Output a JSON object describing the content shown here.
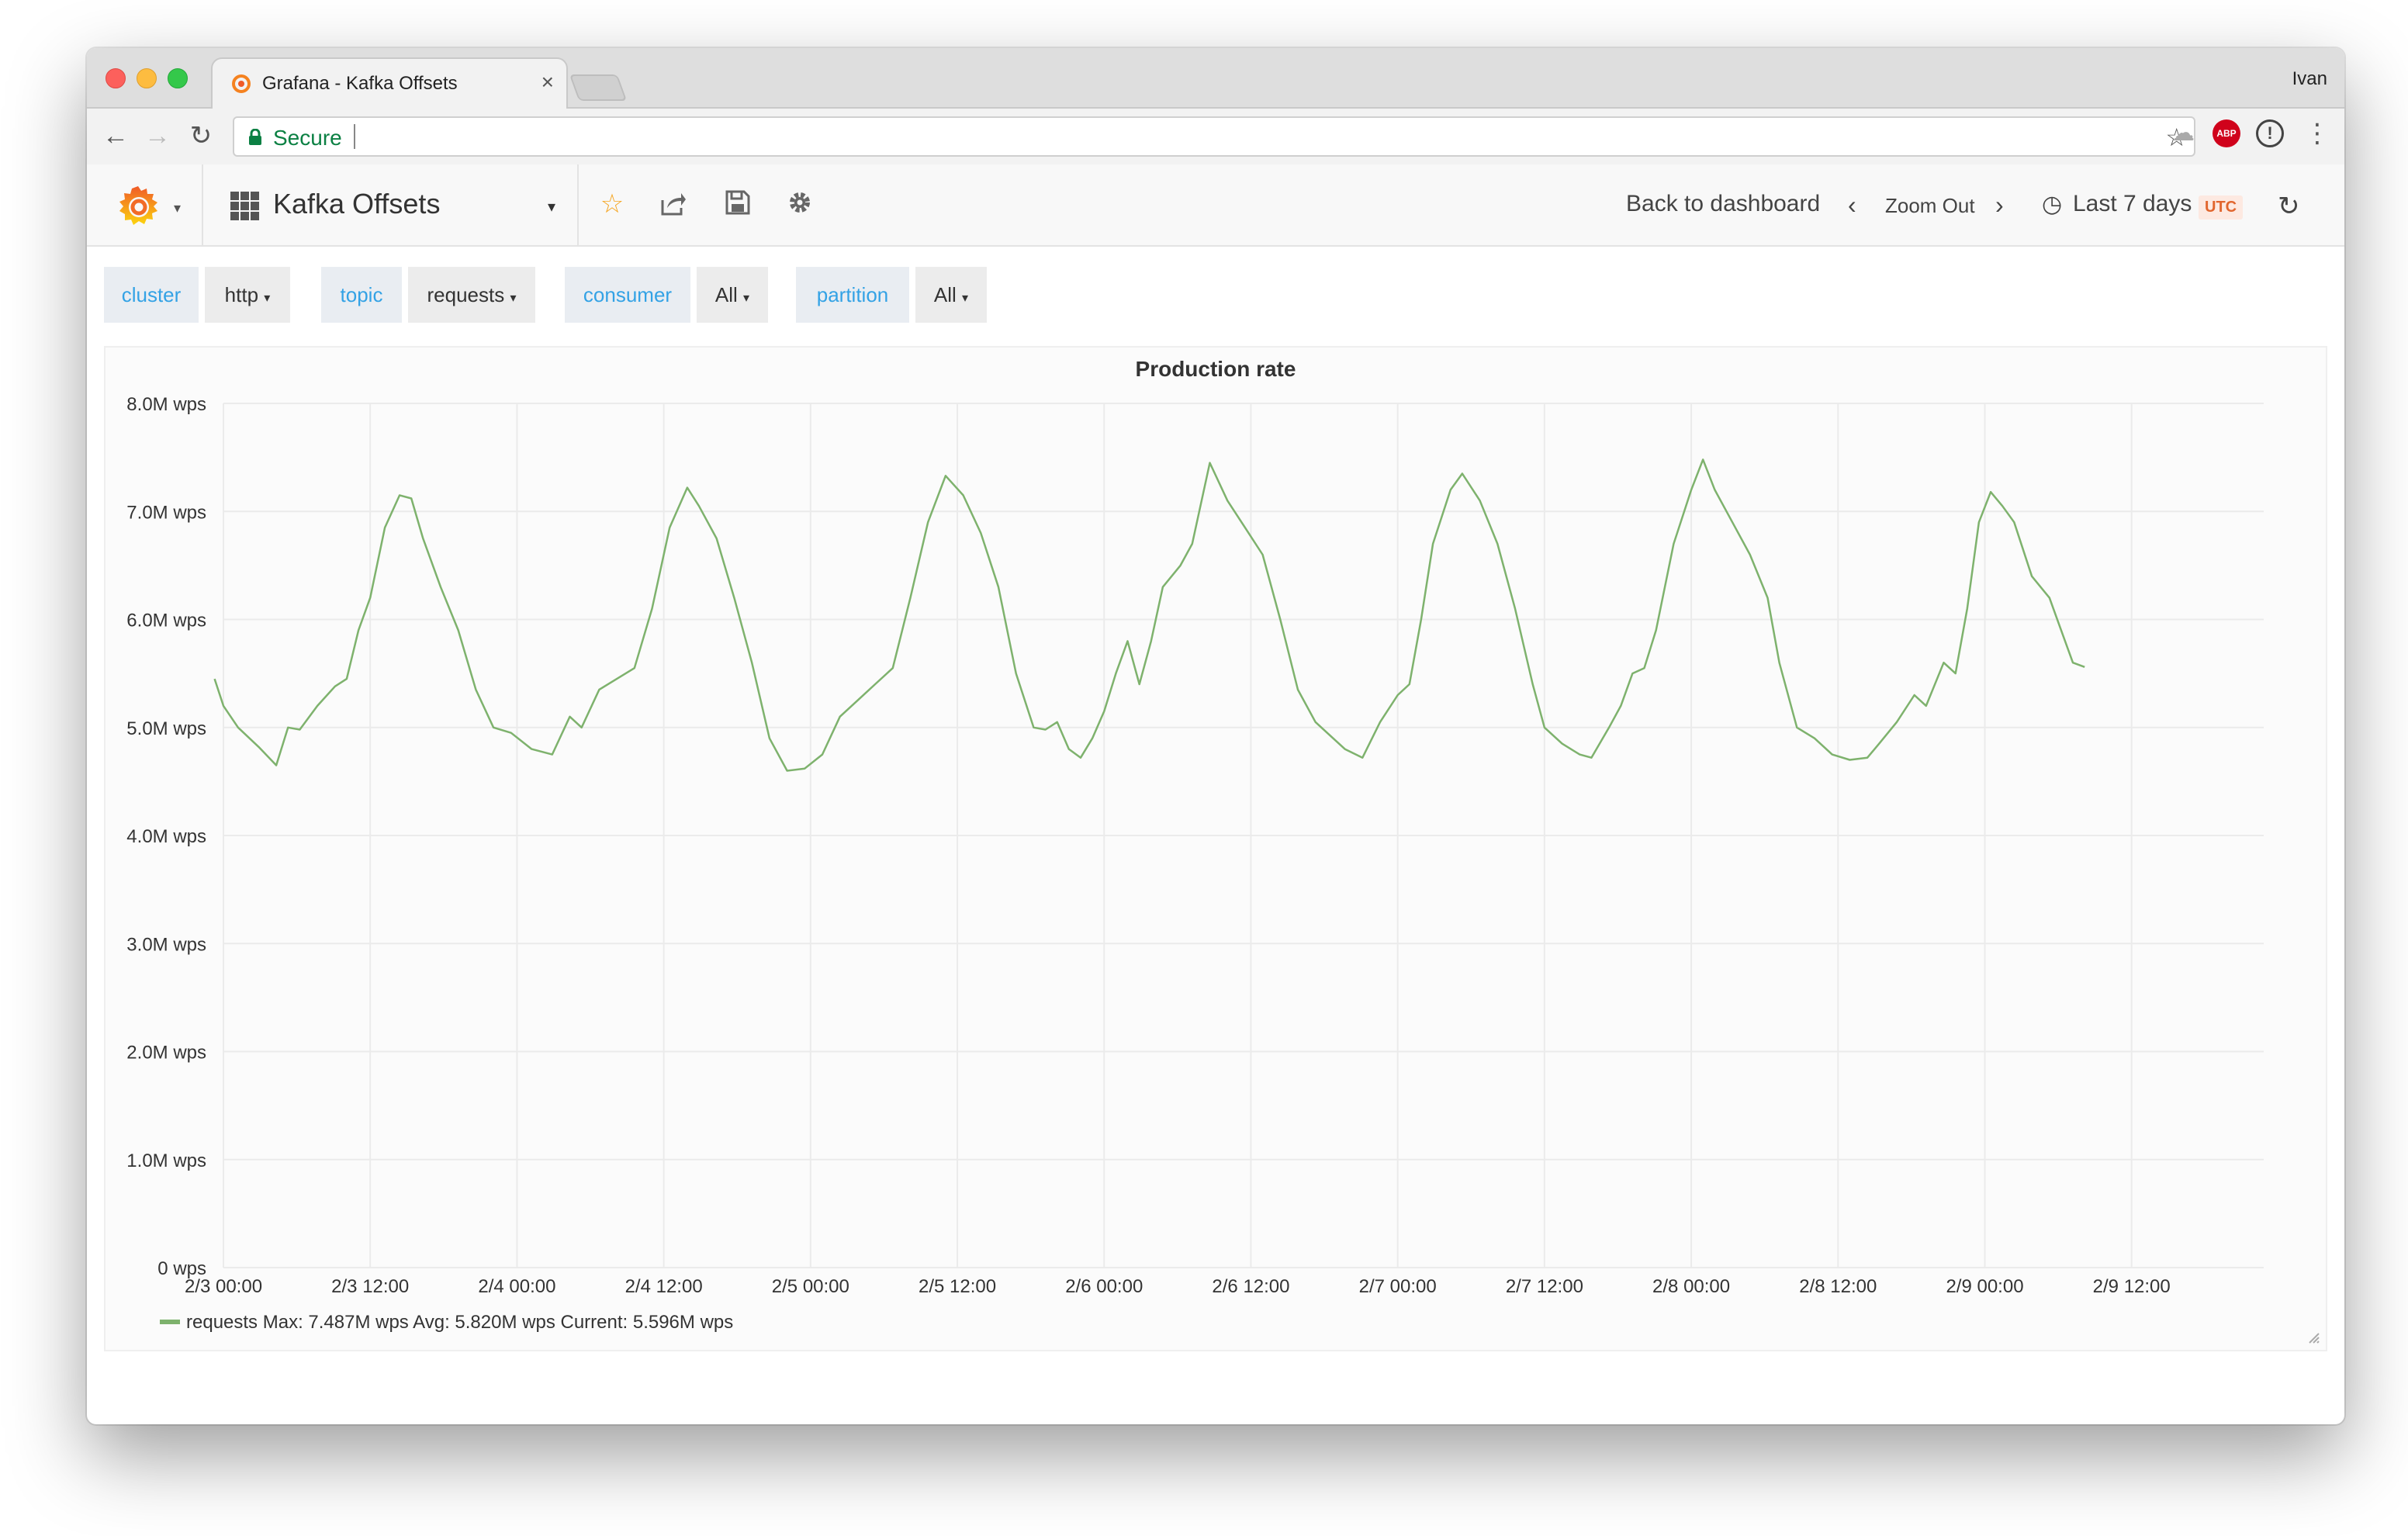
{
  "browser": {
    "tab_title": "Grafana - Kafka Offsets",
    "profile_name": "Ivan",
    "secure_label": "Secure",
    "tab_close": "×",
    "abp_label": "ABP"
  },
  "navbar": {
    "dashboard_title": "Kafka Offsets",
    "back_to_dashboard": "Back to dashboard",
    "zoom_out": "Zoom Out",
    "time_range": "Last 7 days",
    "timezone": "UTC"
  },
  "variables": [
    {
      "label": "cluster",
      "value": "http"
    },
    {
      "label": "topic",
      "value": "requests"
    },
    {
      "label": "consumer",
      "value": "All"
    },
    {
      "label": "partition",
      "value": "All"
    }
  ],
  "panel": {
    "legend": {
      "series_name": "requests",
      "max": "Max: 7.487M wps",
      "avg": "Avg: 5.820M wps",
      "current": "Current: 5.596M wps"
    }
  },
  "colors": {
    "series": "#7eb26d",
    "link": "#33a2e5",
    "utc": "#e1652d"
  },
  "chart_data": {
    "type": "line",
    "title": "Production rate",
    "ylim": [
      0,
      8000000
    ],
    "y_ticks": [
      {
        "value": 0,
        "label": "0 wps"
      },
      {
        "value": 1000000,
        "label": "1.0M wps"
      },
      {
        "value": 2000000,
        "label": "2.0M wps"
      },
      {
        "value": 3000000,
        "label": "3.0M wps"
      },
      {
        "value": 4000000,
        "label": "4.0M wps"
      },
      {
        "value": 5000000,
        "label": "5.0M wps"
      },
      {
        "value": 6000000,
        "label": "6.0M wps"
      },
      {
        "value": 7000000,
        "label": "7.0M wps"
      },
      {
        "value": 8000000,
        "label": "8.0M wps"
      }
    ],
    "x_range_days": [
      0,
      6.95
    ],
    "x_ticks": [
      {
        "value": 0,
        "label": "2/3 00:00"
      },
      {
        "value": 0.5,
        "label": "2/3 12:00"
      },
      {
        "value": 1,
        "label": "2/4 00:00"
      },
      {
        "value": 1.5,
        "label": "2/4 12:00"
      },
      {
        "value": 2,
        "label": "2/5 00:00"
      },
      {
        "value": 2.5,
        "label": "2/5 12:00"
      },
      {
        "value": 3,
        "label": "2/6 00:00"
      },
      {
        "value": 3.5,
        "label": "2/6 12:00"
      },
      {
        "value": 4,
        "label": "2/7 00:00"
      },
      {
        "value": 4.5,
        "label": "2/7 12:00"
      },
      {
        "value": 5,
        "label": "2/8 00:00"
      },
      {
        "value": 5.5,
        "label": "2/8 12:00"
      },
      {
        "value": 6,
        "label": "2/9 00:00"
      },
      {
        "value": 6.5,
        "label": "2/9 12:00"
      }
    ],
    "series": [
      {
        "name": "requests",
        "points": [
          [
            -0.03,
            5.45
          ],
          [
            0.0,
            5.2
          ],
          [
            0.05,
            5.0
          ],
          [
            0.12,
            4.82
          ],
          [
            0.18,
            4.65
          ],
          [
            0.22,
            5.0
          ],
          [
            0.26,
            4.98
          ],
          [
            0.32,
            5.2
          ],
          [
            0.38,
            5.38
          ],
          [
            0.42,
            5.45
          ],
          [
            0.46,
            5.9
          ],
          [
            0.5,
            6.2
          ],
          [
            0.55,
            6.85
          ],
          [
            0.6,
            7.15
          ],
          [
            0.64,
            7.12
          ],
          [
            0.68,
            6.75
          ],
          [
            0.74,
            6.3
          ],
          [
            0.8,
            5.9
          ],
          [
            0.86,
            5.35
          ],
          [
            0.92,
            5.0
          ],
          [
            0.98,
            4.95
          ],
          [
            1.05,
            4.8
          ],
          [
            1.12,
            4.75
          ],
          [
            1.18,
            5.1
          ],
          [
            1.22,
            5.0
          ],
          [
            1.28,
            5.35
          ],
          [
            1.34,
            5.45
          ],
          [
            1.4,
            5.55
          ],
          [
            1.46,
            6.1
          ],
          [
            1.52,
            6.85
          ],
          [
            1.58,
            7.22
          ],
          [
            1.62,
            7.05
          ],
          [
            1.68,
            6.75
          ],
          [
            1.74,
            6.2
          ],
          [
            1.8,
            5.6
          ],
          [
            1.86,
            4.9
          ],
          [
            1.92,
            4.6
          ],
          [
            1.98,
            4.62
          ],
          [
            2.04,
            4.75
          ],
          [
            2.1,
            5.1
          ],
          [
            2.16,
            5.25
          ],
          [
            2.22,
            5.4
          ],
          [
            2.28,
            5.55
          ],
          [
            2.34,
            6.2
          ],
          [
            2.4,
            6.9
          ],
          [
            2.46,
            7.33
          ],
          [
            2.52,
            7.15
          ],
          [
            2.58,
            6.8
          ],
          [
            2.64,
            6.3
          ],
          [
            2.7,
            5.5
          ],
          [
            2.76,
            5.0
          ],
          [
            2.8,
            4.98
          ],
          [
            2.84,
            5.05
          ],
          [
            2.88,
            4.8
          ],
          [
            2.92,
            4.72
          ],
          [
            2.96,
            4.9
          ],
          [
            3.0,
            5.15
          ],
          [
            3.04,
            5.5
          ],
          [
            3.08,
            5.8
          ],
          [
            3.12,
            5.4
          ],
          [
            3.16,
            5.8
          ],
          [
            3.2,
            6.3
          ],
          [
            3.26,
            6.5
          ],
          [
            3.3,
            6.7
          ],
          [
            3.36,
            7.45
          ],
          [
            3.42,
            7.1
          ],
          [
            3.48,
            6.85
          ],
          [
            3.54,
            6.6
          ],
          [
            3.6,
            6.0
          ],
          [
            3.66,
            5.35
          ],
          [
            3.72,
            5.05
          ],
          [
            3.76,
            4.95
          ],
          [
            3.82,
            4.8
          ],
          [
            3.88,
            4.72
          ],
          [
            3.94,
            5.05
          ],
          [
            4.0,
            5.3
          ],
          [
            4.04,
            5.4
          ],
          [
            4.08,
            6.0
          ],
          [
            4.12,
            6.7
          ],
          [
            4.18,
            7.2
          ],
          [
            4.22,
            7.35
          ],
          [
            4.28,
            7.1
          ],
          [
            4.34,
            6.7
          ],
          [
            4.4,
            6.1
          ],
          [
            4.46,
            5.4
          ],
          [
            4.5,
            5.0
          ],
          [
            4.56,
            4.85
          ],
          [
            4.62,
            4.75
          ],
          [
            4.66,
            4.72
          ],
          [
            4.72,
            5.0
          ],
          [
            4.76,
            5.2
          ],
          [
            4.8,
            5.5
          ],
          [
            4.84,
            5.55
          ],
          [
            4.88,
            5.9
          ],
          [
            4.94,
            6.7
          ],
          [
            5.0,
            7.2
          ],
          [
            5.04,
            7.48
          ],
          [
            5.08,
            7.2
          ],
          [
            5.14,
            6.9
          ],
          [
            5.2,
            6.6
          ],
          [
            5.26,
            6.2
          ],
          [
            5.3,
            5.6
          ],
          [
            5.36,
            5.0
          ],
          [
            5.42,
            4.9
          ],
          [
            5.48,
            4.75
          ],
          [
            5.54,
            4.7
          ],
          [
            5.6,
            4.72
          ],
          [
            5.64,
            4.85
          ],
          [
            5.7,
            5.05
          ],
          [
            5.76,
            5.3
          ],
          [
            5.8,
            5.2
          ],
          [
            5.86,
            5.6
          ],
          [
            5.9,
            5.5
          ],
          [
            5.94,
            6.1
          ],
          [
            5.98,
            6.9
          ],
          [
            6.02,
            7.18
          ],
          [
            6.06,
            7.05
          ],
          [
            6.1,
            6.9
          ],
          [
            6.16,
            6.4
          ],
          [
            6.22,
            6.2
          ],
          [
            6.26,
            5.9
          ],
          [
            6.3,
            5.6
          ],
          [
            6.34,
            5.56
          ]
        ]
      }
    ]
  }
}
